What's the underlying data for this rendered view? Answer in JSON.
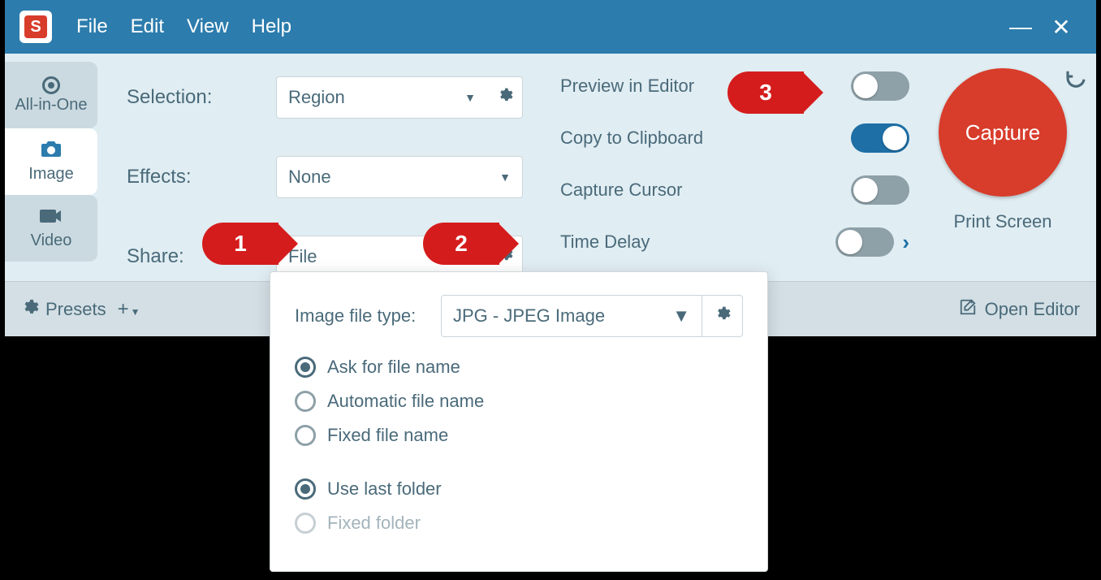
{
  "titlebar": {
    "logo_letter": "S",
    "menu": {
      "file": "File",
      "edit": "Edit",
      "view": "View",
      "help": "Help"
    },
    "minimize": "—",
    "close": "✕"
  },
  "tabs": {
    "allinone": "All-in-One",
    "image": "Image",
    "video": "Video"
  },
  "form": {
    "selection_label": "Selection:",
    "selection_value": "Region",
    "effects_label": "Effects:",
    "effects_value": "None",
    "share_label": "Share:",
    "share_value": "File"
  },
  "toggles": {
    "preview": "Preview in Editor",
    "clipboard": "Copy to Clipboard",
    "cursor": "Capture Cursor",
    "delay": "Time Delay"
  },
  "capture": {
    "button": "Capture",
    "shortcut": "Print Screen"
  },
  "footer": {
    "presets": "Presets",
    "open_editor": "Open Editor"
  },
  "popup": {
    "filetype_label": "Image file type:",
    "filetype_value": "JPG - JPEG Image",
    "radios": {
      "ask": "Ask for file name",
      "auto": "Automatic file name",
      "fixed": "Fixed file name",
      "last_folder": "Use last folder",
      "fixed_folder": "Fixed folder"
    }
  },
  "callouts": {
    "c1": "1",
    "c2": "2",
    "c3": "3"
  }
}
